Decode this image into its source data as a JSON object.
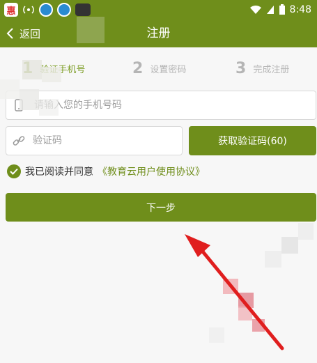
{
  "status_bar": {
    "time": "8:48",
    "icons": [
      "app-icon-red",
      "signal-icon",
      "app-icon-blue-1",
      "app-icon-blue-2",
      "app-icon-dark",
      "wifi-icon",
      "cell-signal-icon",
      "battery-icon"
    ]
  },
  "header": {
    "back_label": "返回",
    "title": "注册"
  },
  "steps": [
    {
      "num": "1",
      "label": "验证手机号"
    },
    {
      "num": "2",
      "label": "设置密码"
    },
    {
      "num": "3",
      "label": "完成注册"
    }
  ],
  "phone": {
    "placeholder": "请输入您的手机号码"
  },
  "code": {
    "placeholder": "验证码"
  },
  "get_code_button": "获取验证码(60)",
  "agreement": {
    "prefix": "我已阅读并同意",
    "link": "《教育云用户使用协议》"
  },
  "next_button": "下一步",
  "colors": {
    "accent": "#6f8e1b",
    "arrow": "#e01e1e",
    "inactive": "#b5b5b5"
  }
}
